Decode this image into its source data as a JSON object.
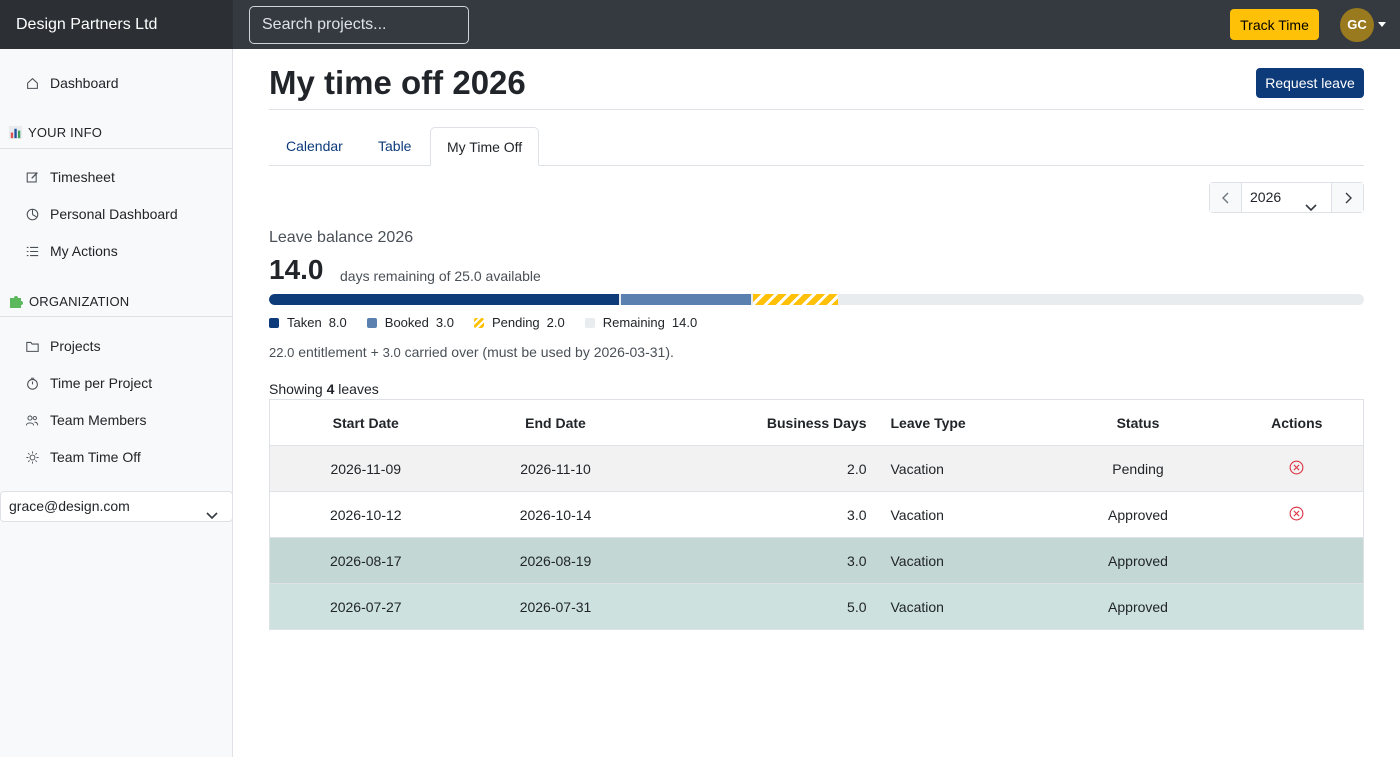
{
  "topbar": {
    "brand": "Design Partners Ltd",
    "search_placeholder": "Search projects...",
    "track_time_label": "Track Time",
    "avatar_initials": "GC"
  },
  "sidebar": {
    "dashboard": "Dashboard",
    "your_info_heading": "YOUR INFO",
    "your_info_items": [
      "Timesheet",
      "Personal Dashboard",
      "My Actions"
    ],
    "organization_heading": "ORGANIZATION",
    "organization_items": [
      "Projects",
      "Time per Project",
      "Team Members",
      "Team Time Off"
    ],
    "user_select_value": "grace@design.com"
  },
  "main": {
    "title": "My time off 2026",
    "request_leave_label": "Request leave",
    "tabs": [
      "Calendar",
      "Table",
      "My Time Off"
    ],
    "active_tab": "My Time Off",
    "year_selector": "2026",
    "leave_balance": {
      "title": "Leave balance 2026",
      "remaining_big": "14.0",
      "remaining_text": "days remaining of 25.0 available",
      "total": 25.0,
      "legend": [
        {
          "label": "Taken",
          "value": "8.0",
          "color": "#0d3b7a"
        },
        {
          "label": "Booked",
          "value": "3.0",
          "color": "#5a80b0"
        },
        {
          "label": "Pending",
          "value": "2.0",
          "color": "#ffc107"
        },
        {
          "label": "Remaining",
          "value": "14.0",
          "color": "#e9ecef"
        }
      ],
      "entitlement_value": "22.0",
      "entitlement_text": "entitlement +",
      "carried_value": "3.0",
      "carried_text": "carried over (must be used by 2026-03-31)."
    },
    "showing_prefix": "Showing",
    "showing_count": "4",
    "showing_suffix": "leaves",
    "table": {
      "headers": [
        "Start Date",
        "End Date",
        "Business Days",
        "Leave Type",
        "Status",
        "Actions"
      ],
      "rows": [
        {
          "start": "2026-11-09",
          "end": "2026-11-10",
          "days": "2.0",
          "type": "Vacation",
          "status": "Pending",
          "cancel": true
        },
        {
          "start": "2026-10-12",
          "end": "2026-10-14",
          "days": "3.0",
          "type": "Vacation",
          "status": "Approved",
          "cancel": true
        },
        {
          "start": "2026-08-17",
          "end": "2026-08-19",
          "days": "3.0",
          "type": "Vacation",
          "status": "Approved",
          "cancel": false
        },
        {
          "start": "2026-07-27",
          "end": "2026-07-31",
          "days": "5.0",
          "type": "Vacation",
          "status": "Approved",
          "cancel": false
        }
      ]
    }
  }
}
